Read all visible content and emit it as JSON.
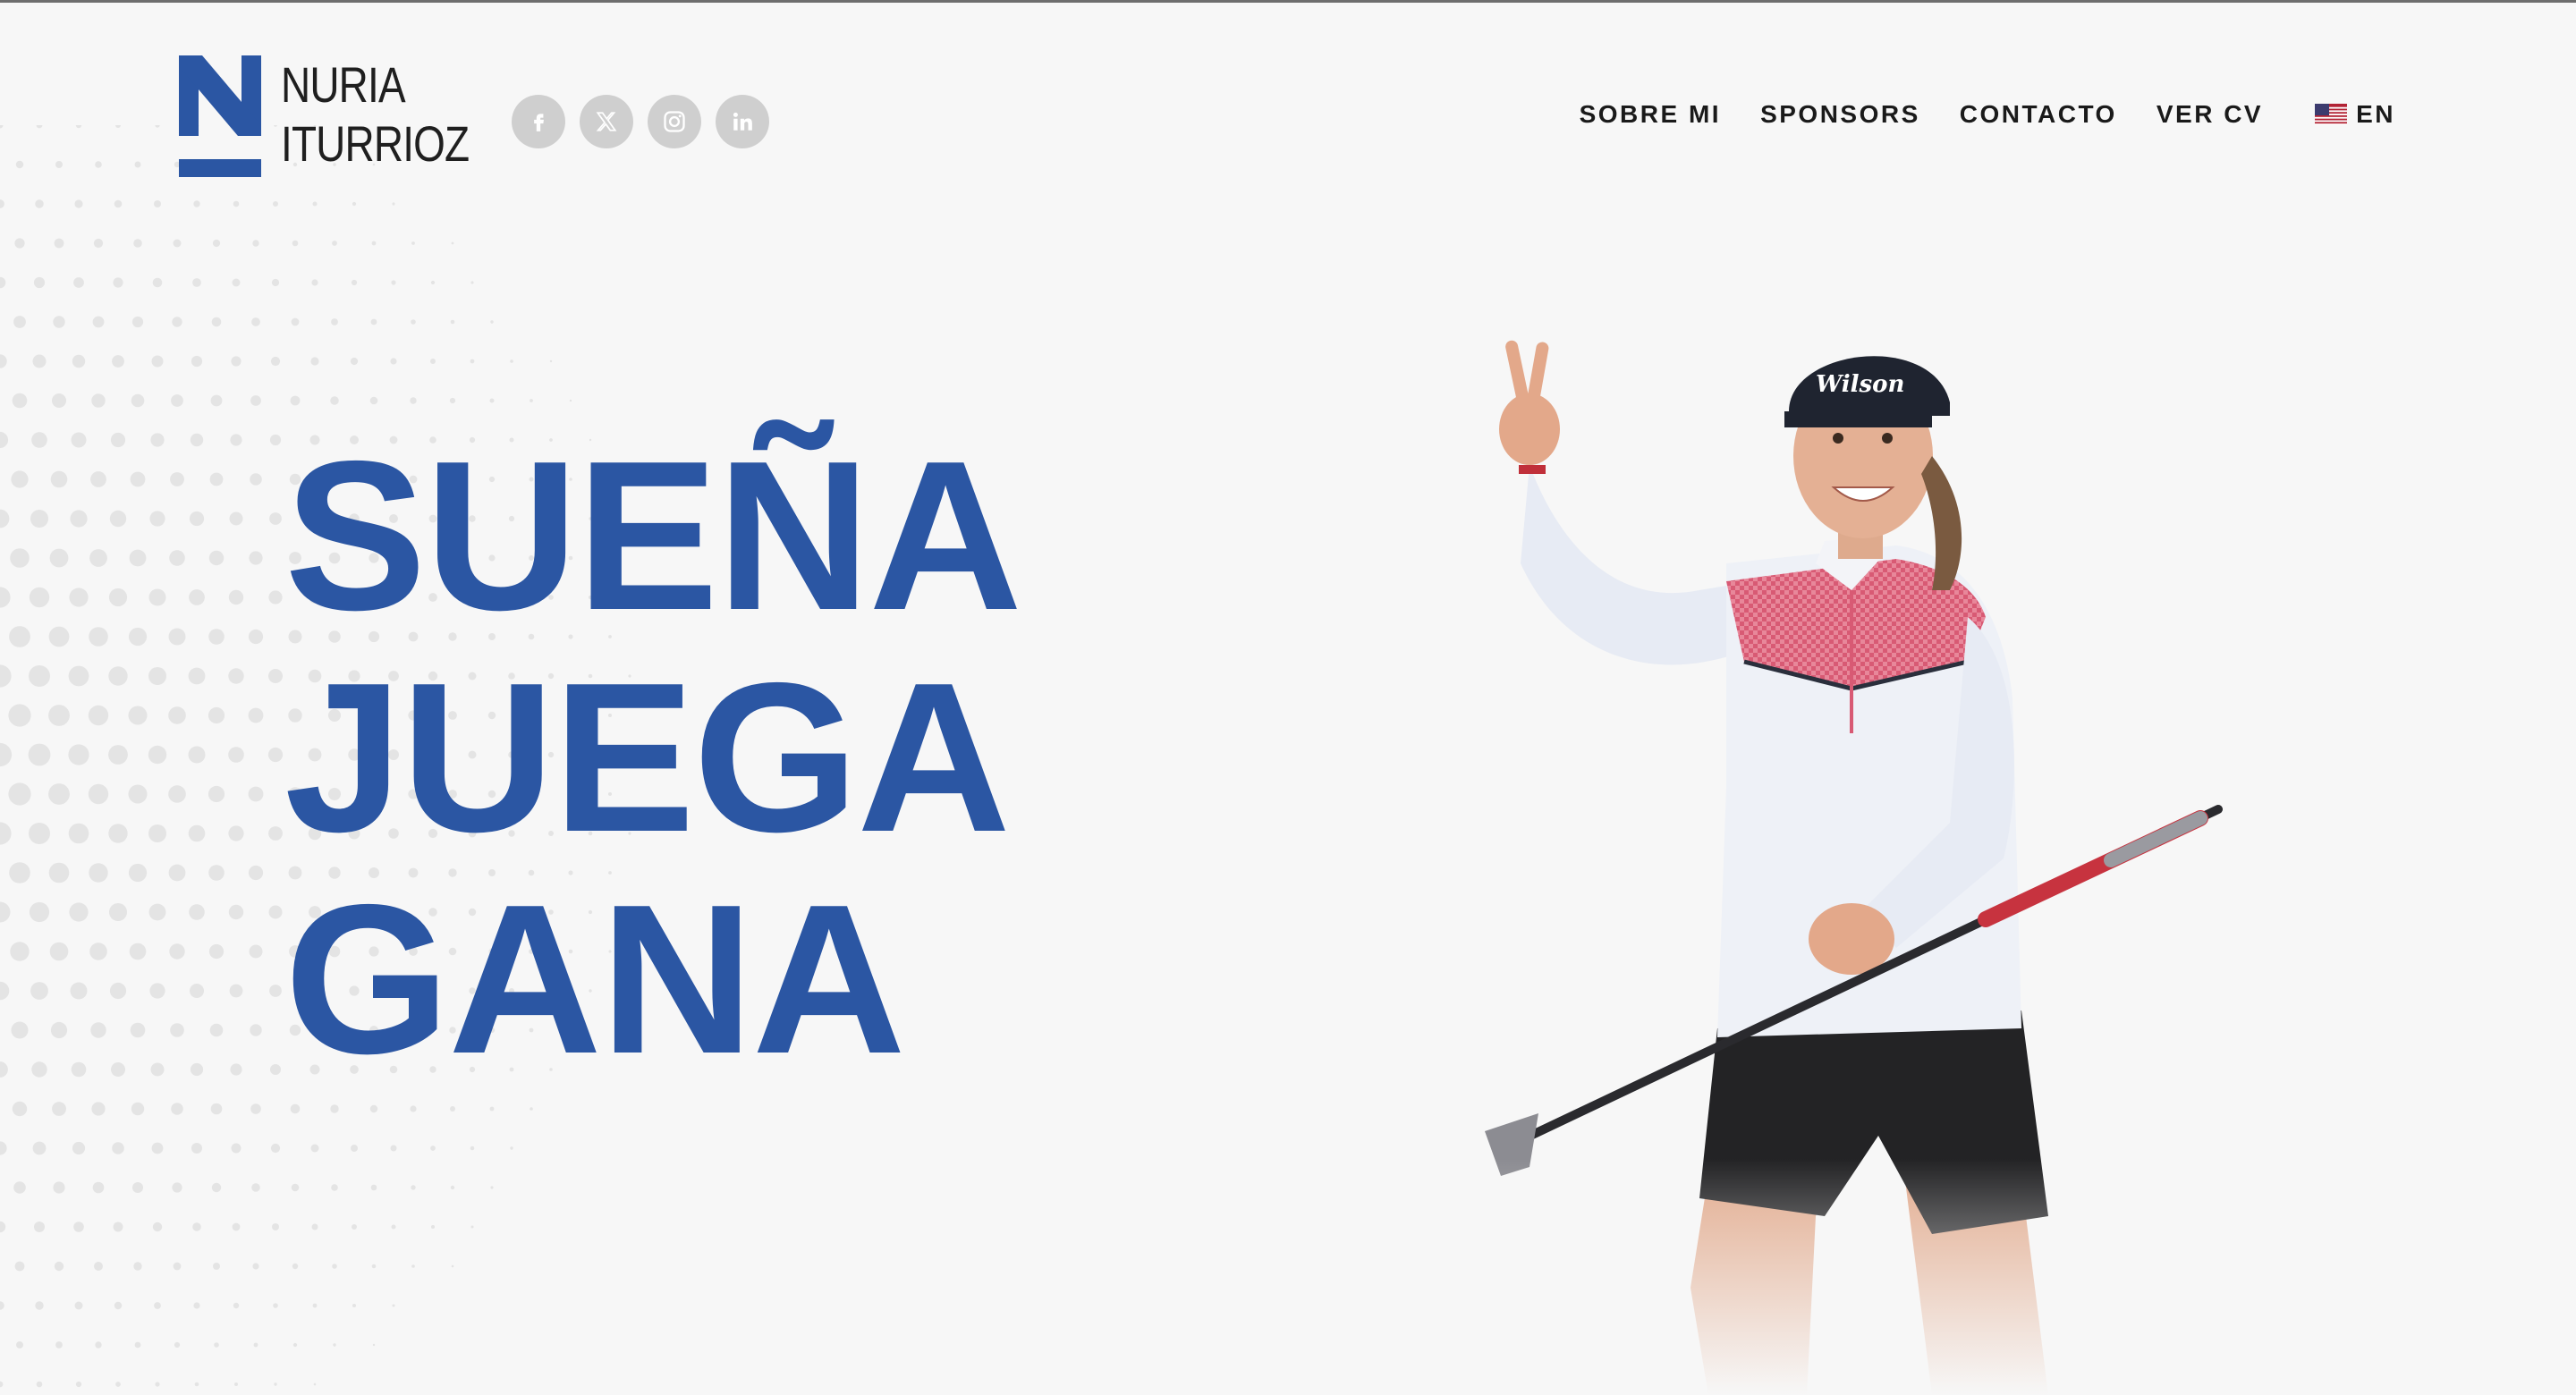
{
  "brand": {
    "name_line1": "NURIA",
    "name_line2": "ITURRIOZ",
    "mark_letter": "N",
    "accent_color": "#2b56a3"
  },
  "socials": [
    {
      "name": "facebook",
      "icon": "facebook-icon"
    },
    {
      "name": "x",
      "icon": "x-icon"
    },
    {
      "name": "instagram",
      "icon": "instagram-icon"
    },
    {
      "name": "linkedin",
      "icon": "linkedin-icon"
    }
  ],
  "nav": {
    "items": [
      {
        "label": "SOBRE MI"
      },
      {
        "label": "SPONSORS"
      },
      {
        "label": "CONTACTO"
      },
      {
        "label": "VER CV"
      }
    ],
    "language": {
      "label": "EN",
      "flag_icon": "us-flag-icon"
    }
  },
  "hero": {
    "lines": [
      "SUEÑA",
      "JUEGA",
      "GANA"
    ]
  }
}
